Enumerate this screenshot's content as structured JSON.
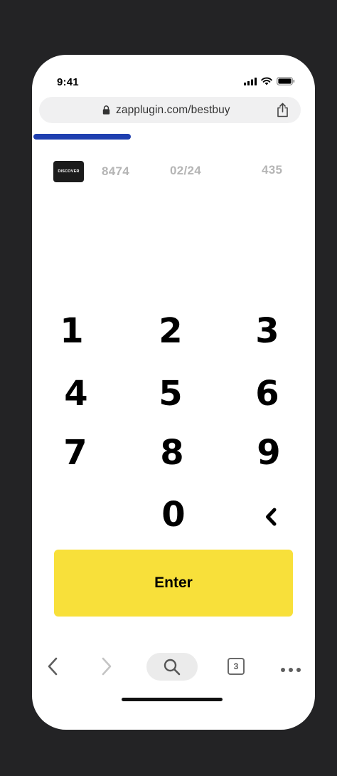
{
  "status_bar": {
    "time": "9:41",
    "icons": [
      "signal-icon",
      "wifi-icon",
      "battery-icon"
    ]
  },
  "browser": {
    "url": "zapplugin.com/bestbuy",
    "lock_icon": "lock-icon",
    "share_icon": "share-icon"
  },
  "progress": {
    "fraction": 0.59,
    "color": "#1f3fb0"
  },
  "card": {
    "brand": "DISCOVER",
    "last4": "8474",
    "expiry": "02/24",
    "cvv": "435"
  },
  "keypad": {
    "keys": [
      "1",
      "2",
      "3",
      "4",
      "5",
      "6",
      "7",
      "8",
      "9",
      "0"
    ],
    "backspace_icon": "chevron-left-icon"
  },
  "enter_button": {
    "label": "Enter",
    "color": "#f8e03a"
  },
  "toolbar": {
    "tab_count": "3",
    "icons": [
      "back-icon",
      "forward-icon",
      "search-icon",
      "tabs-icon",
      "more-icon"
    ]
  }
}
